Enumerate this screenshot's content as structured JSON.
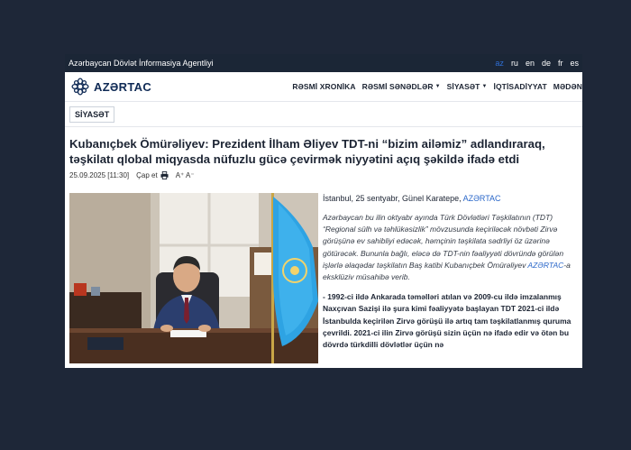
{
  "agency_bar": {
    "name": "Azərbaycan Dövlət İnformasiya Agentliyi",
    "languages": [
      {
        "code": "az",
        "active": true
      },
      {
        "code": "ru",
        "active": false
      },
      {
        "code": "en",
        "active": false
      },
      {
        "code": "de",
        "active": false
      },
      {
        "code": "fr",
        "active": false
      },
      {
        "code": "es",
        "active": false
      }
    ]
  },
  "header": {
    "logo_text": "AZƏRTAC",
    "nav": [
      {
        "label": "RƏSMİ XRONİKA",
        "dropdown": false
      },
      {
        "label": "RƏSMİ SƏNƏDLƏR",
        "dropdown": true
      },
      {
        "label": "SİYASƏT",
        "dropdown": true
      },
      {
        "label": "İQTİSADİYYAT",
        "dropdown": false
      },
      {
        "label": "MƏDƏN",
        "dropdown": false
      }
    ]
  },
  "section": {
    "tag": "SİYASƏT"
  },
  "article": {
    "headline": "Kubanıçbek Ömürəliyev: Prezident İlham Əliyev TDT-ni “bizim ailəmiz” adlandıraraq, təşkilatı qlobal miqyasda nüfuzlu gücə çevirmək niyyətini açıq şəkildə ifadə etdi",
    "date": "25.09.2025 [11:30]",
    "print_label": "Çap et",
    "font_size_label": "A⁺ A⁻",
    "byline_prefix": "İstanbul, 25 sentyabr, Günel Karatepe, ",
    "byline_agency": "AZƏRTAC",
    "lead_text": "Azərbaycan bu ilin oktyabr ayında Türk Dövlətləri Təşkilatının (TDT) “Regional sülh və təhlükəsizlik” mövzusunda keçiriləcək növbəti Zirvə görüşünə ev sahibliyi edəcək, həmçinin təşkilata sədrliyi öz üzərinə götürəcək. Bununla bağlı, eləcə də TDT-nin fəaliyyəti dövründə görülən işlərlə əlaqədar təşkilatın Baş katibi Kubanıçbek Ömürəliyev ",
    "lead_agency": "AZƏRTAC",
    "lead_suffix": "-a eksklüziv müsahibə verib.",
    "question": "- 1992-ci ildə Ankarada təməlləri atılan və 2009-cu ildə imzalanmış Naxçıvan Sazişi ilə şura kimi fəaliyyətə başlayan TDT 2021-ci ildə İstanbulda keçirilən Zirvə görüşü ilə artıq tam təşkilatlanmış quruma çevrildi. 2021-ci ilin Zirvə görüşü sizin üçün nə ifadə edir və ötən bu dövrdə türkdilli dövlətlər üçün nə"
  },
  "colors": {
    "background": "#1e2738",
    "agency_bar": "#1b2636",
    "accent_link": "#2a67c9",
    "brand": "#0f2a55",
    "flag_blue": "#2ea3e3"
  }
}
